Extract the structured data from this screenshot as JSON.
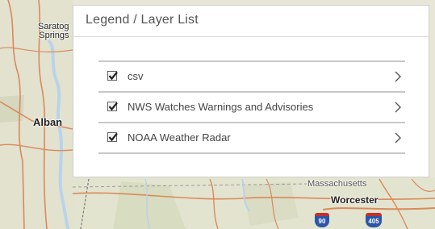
{
  "panel": {
    "title": "Legend / Layer List",
    "layers": [
      {
        "label": "csv",
        "checked": true
      },
      {
        "label": "NWS Watches Warnings and Advisories",
        "checked": true
      },
      {
        "label": "NOAA Weather Radar",
        "checked": true
      }
    ]
  },
  "map": {
    "labels": {
      "saratoga": "Saratog\nSprings",
      "albany": "Alban",
      "massachusetts": "Massachusetts",
      "worcester": "Worcester"
    },
    "shields": {
      "i90": "90",
      "i405": "405"
    },
    "colors": {
      "terrain": "#e8e6d6",
      "roads": "#d98a5c",
      "water": "#b9d3ea",
      "boundary": "#9b9b9b"
    }
  },
  "icons": {
    "checkbox": "checkmark-icon",
    "chevron": "chevron-right-icon"
  }
}
